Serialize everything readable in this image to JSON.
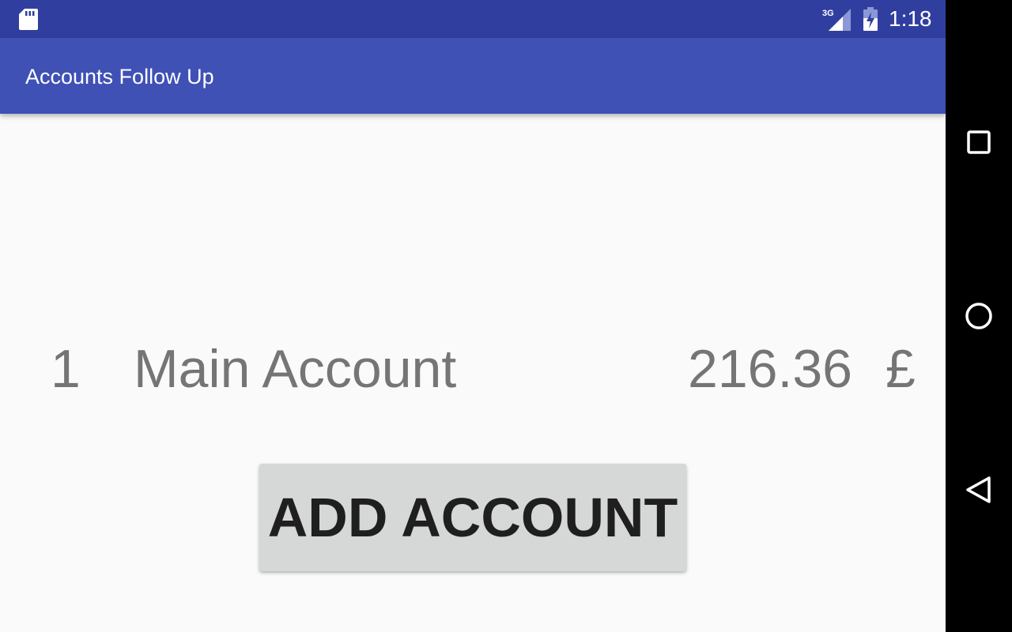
{
  "status_bar": {
    "time": "1:18",
    "network": "3G",
    "icons": [
      "sd-card-icon",
      "signal-3g-icon",
      "battery-charging-icon"
    ],
    "color": "#303f9f"
  },
  "app_bar": {
    "title": "Accounts Follow Up",
    "color": "#3f51b5"
  },
  "accounts": [
    {
      "number": "1",
      "name": "Main Account",
      "balance": "216.36",
      "currency": "£"
    }
  ],
  "actions": {
    "add_account_label": "ADD ACCOUNT"
  },
  "nav_bar": {
    "buttons": [
      "recents-icon",
      "home-icon",
      "back-icon"
    ]
  }
}
